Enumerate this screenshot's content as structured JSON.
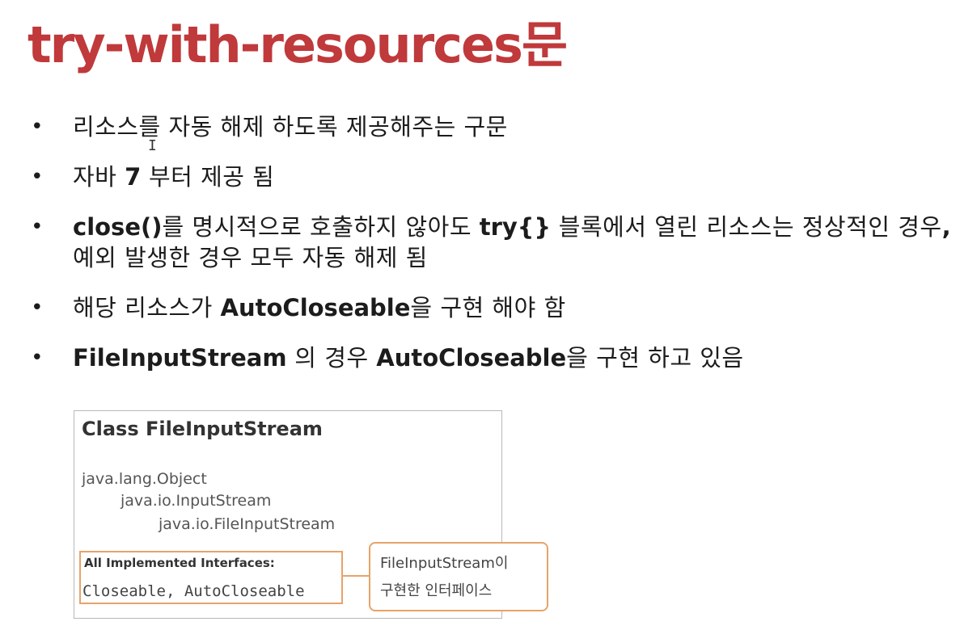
{
  "title": "try-with-resources문",
  "bullets": [
    {
      "marker": "•",
      "runs": [
        {
          "text": "리소스를 자동 해제 하도록 제공해주는 구문",
          "bold": false
        }
      ]
    },
    {
      "marker": "•",
      "runs": [
        {
          "text": "자바 ",
          "bold": false
        },
        {
          "text": "7",
          "bold": true
        },
        {
          "text": " 부터 제공 됨",
          "bold": false
        }
      ]
    },
    {
      "marker": "•",
      "runs": [
        {
          "text": "close()",
          "bold": true
        },
        {
          "text": "를 명시적으로 호출하지 않아도 ",
          "bold": false
        },
        {
          "text": "try{}",
          "bold": true
        },
        {
          "text": " 블록에서 열린 리소스는 정상적인 경우",
          "bold": false
        },
        {
          "text": ",",
          "bold": true
        },
        {
          "text": " 예외 발생한 경우 모두 자동 해제 됨",
          "bold": false
        }
      ]
    },
    {
      "marker": "•",
      "runs": [
        {
          "text": "해당 리소스가 ",
          "bold": false
        },
        {
          "text": "AutoCloseable",
          "bold": true
        },
        {
          "text": "을 구현 해야 함",
          "bold": false
        }
      ]
    },
    {
      "marker": "•",
      "runs": [
        {
          "text": "FileInputStream",
          "bold": true
        },
        {
          "text": " 의 경우 ",
          "bold": false
        },
        {
          "text": "AutoCloseable",
          "bold": true
        },
        {
          "text": "을 구현 하고 있음",
          "bold": false
        }
      ]
    }
  ],
  "doc_box": {
    "heading": "Class FileInputStream",
    "hierarchy": [
      "java.lang.Object",
      "java.io.InputStream",
      "java.io.FileInputStream"
    ],
    "interfaces_label": "All Implemented Interfaces:",
    "interfaces_value": "Closeable, AutoCloseable"
  },
  "callout": {
    "line1": "FileInputStream이",
    "line2": "구현한 인터페이스"
  },
  "cursor": {
    "glyph": "I",
    "icon": "text-cursor-icon"
  },
  "colors": {
    "title": "#c0393b",
    "callout_border": "#e7a36a",
    "body_text": "#1c1c1c"
  }
}
